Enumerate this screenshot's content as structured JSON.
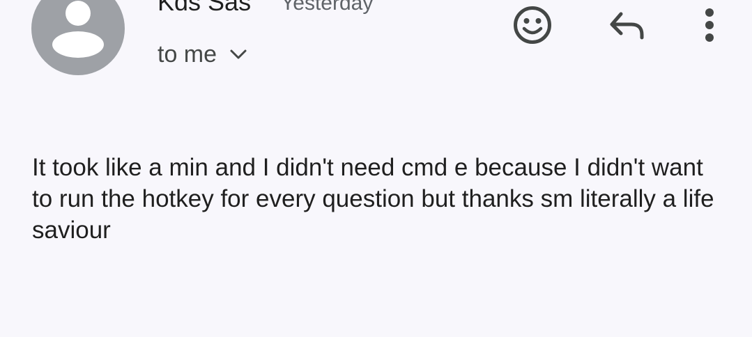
{
  "message": {
    "sender_name": "Kds Sas",
    "time": "Yesterday",
    "recipients_label": "to me",
    "body": "It took like a min and I didn't need cmd e because I didn't want to run the hotkey for every question but thanks sm literally a life saviour"
  },
  "icons": {
    "avatar": "person-placeholder-icon",
    "recipients_toggle": "chevron-down-icon",
    "emoji": "smiley-face-icon",
    "reply": "reply-arrow-icon",
    "more": "more-vert-icon"
  },
  "colors": {
    "background": "#f8f7fc",
    "avatar_bg": "#9ea1a6",
    "text_primary": "#1f1f1f",
    "text_secondary": "#5f6368",
    "icon": "#444746"
  }
}
